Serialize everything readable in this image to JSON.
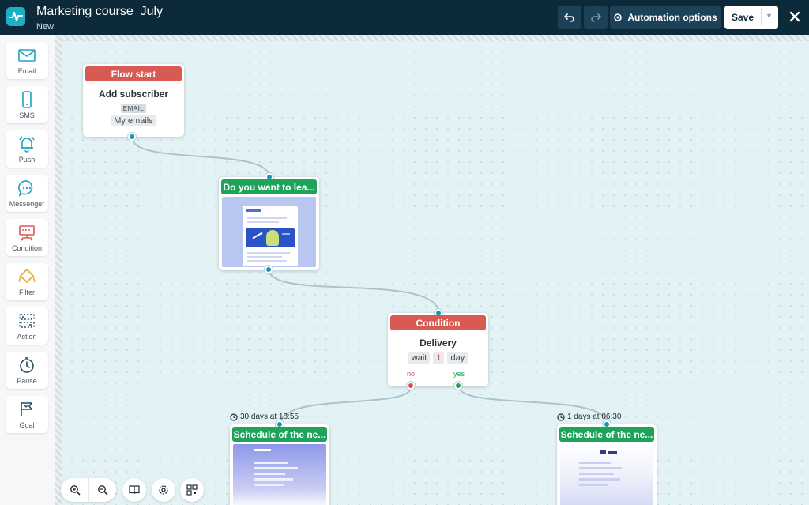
{
  "header": {
    "title": "Marketing course_July",
    "subtitle": "New",
    "automation_options_label": "Automation options",
    "save_label": "Save"
  },
  "sidebar": {
    "items": [
      {
        "label": "Email",
        "icon": "envelope-icon"
      },
      {
        "label": "SMS",
        "icon": "phone-icon"
      },
      {
        "label": "Push",
        "icon": "bell-icon"
      },
      {
        "label": "Messenger",
        "icon": "chat-bubble-icon"
      },
      {
        "label": "Condition",
        "icon": "condition-icon"
      },
      {
        "label": "Filter",
        "icon": "filter-icon"
      },
      {
        "label": "Action",
        "icon": "action-icon"
      },
      {
        "label": "Pause",
        "icon": "clock-icon"
      },
      {
        "label": "Goal",
        "icon": "flag-icon"
      }
    ]
  },
  "nodes": {
    "flow_start": {
      "header": "Flow start",
      "title": "Add subscriber",
      "badge": "EMAIL",
      "list": "My emails"
    },
    "email_1": {
      "header": "Do you want to lea..."
    },
    "condition": {
      "header": "Condition",
      "title": "Delivery",
      "wait_label": "wait",
      "wait_value": "1",
      "wait_unit": "day",
      "no_label": "no",
      "yes_label": "yes"
    },
    "email_no": {
      "schedule": "30 days at 18:55",
      "header": "Schedule of the ne..."
    },
    "email_yes": {
      "schedule": "1 days at 06:30",
      "header": "Schedule of the ne..."
    }
  },
  "colors": {
    "header_bg": "#0d2a3a",
    "accent": "#1cb0c8",
    "start_red": "#d95a52",
    "email_green": "#1ea35b",
    "canvas_bg": "#e3f2f4"
  }
}
